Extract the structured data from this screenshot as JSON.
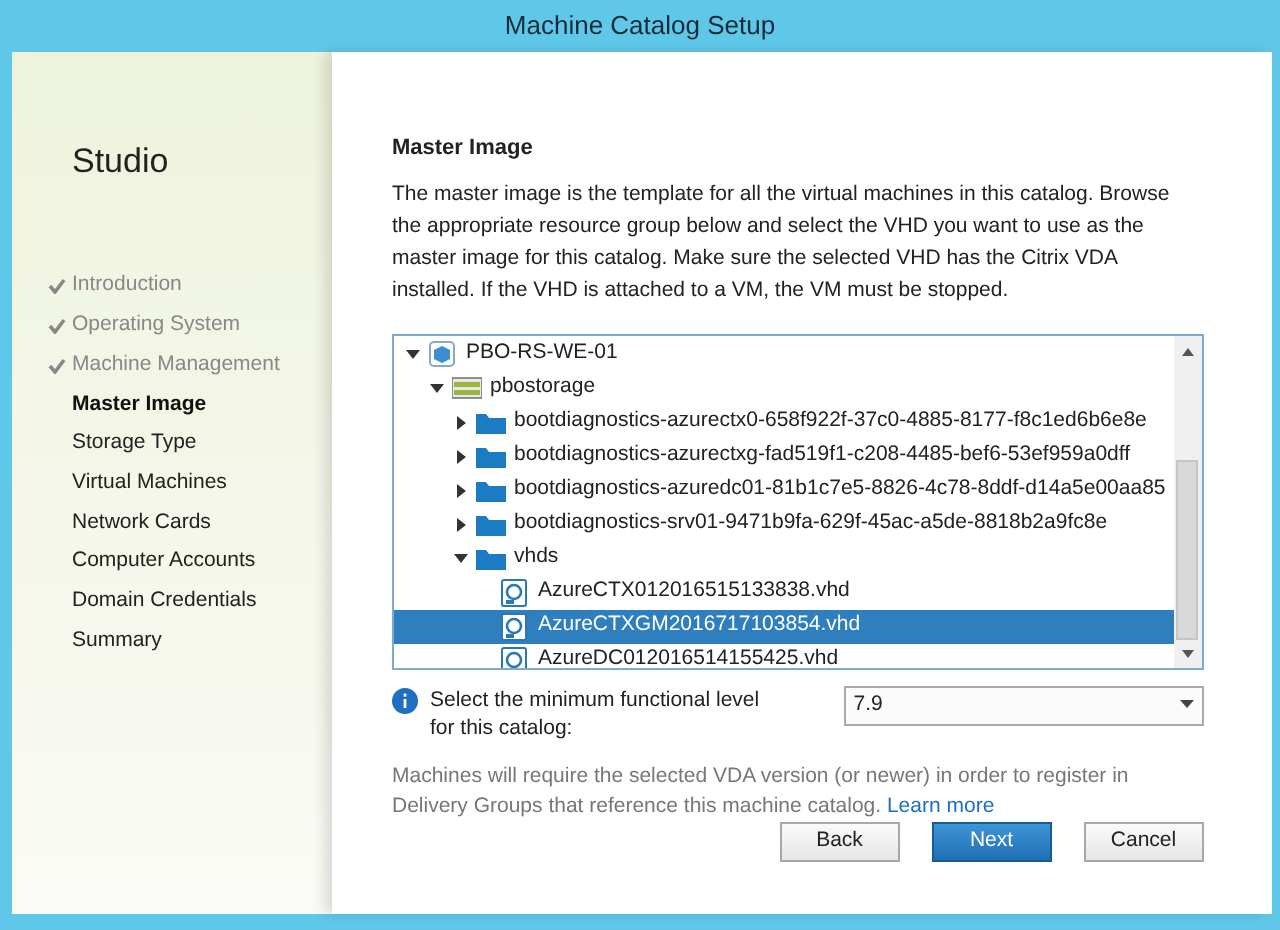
{
  "window": {
    "title": "Machine Catalog Setup"
  },
  "sidebar": {
    "title": "Studio",
    "items": [
      {
        "label": "Introduction",
        "done": true,
        "selected": false
      },
      {
        "label": "Operating System",
        "done": true,
        "selected": false
      },
      {
        "label": "Machine Management",
        "done": true,
        "selected": false
      },
      {
        "label": "Master Image",
        "done": false,
        "selected": true
      },
      {
        "label": "Storage Type",
        "done": false,
        "selected": false
      },
      {
        "label": "Virtual Machines",
        "done": false,
        "selected": false
      },
      {
        "label": "Network Cards",
        "done": false,
        "selected": false
      },
      {
        "label": "Computer Accounts",
        "done": false,
        "selected": false
      },
      {
        "label": "Domain Credentials",
        "done": false,
        "selected": false
      },
      {
        "label": "Summary",
        "done": false,
        "selected": false
      }
    ]
  },
  "page": {
    "heading": "Master Image",
    "description": "The master image is the template for all the virtual machines in this catalog. Browse the appropriate resource group below and select the VHD you want to use as the master image for this catalog. Make sure the selected VHD has the Citrix VDA installed. If the VHD is attached to a VM, the VM must be stopped.",
    "tree": [
      {
        "label": "PBO-RS-WE-01",
        "kind": "group",
        "expanded": true,
        "selected": false,
        "children": [
          {
            "label": "pbostorage",
            "kind": "storage",
            "expanded": true,
            "selected": false,
            "children": [
              {
                "label": "bootdiagnostics-azurectx0-658f922f-37c0-4885-8177-f8c1ed6b6e8e",
                "kind": "folder",
                "expanded": false,
                "selected": false
              },
              {
                "label": "bootdiagnostics-azurectxg-fad519f1-c208-4485-bef6-53ef959a0dff",
                "kind": "folder",
                "expanded": false,
                "selected": false
              },
              {
                "label": "bootdiagnostics-azuredc01-81b1c7e5-8826-4c78-8ddf-d14a5e00aa85",
                "kind": "folder",
                "expanded": false,
                "selected": false
              },
              {
                "label": "bootdiagnostics-srv01-9471b9fa-629f-45ac-a5de-8818b2a9fc8e",
                "kind": "folder",
                "expanded": false,
                "selected": false
              },
              {
                "label": "vhds",
                "kind": "folder",
                "expanded": true,
                "selected": false,
                "children": [
                  {
                    "label": "AzureCTX012016515133838.vhd",
                    "kind": "disk",
                    "selected": false
                  },
                  {
                    "label": "AzureCTXGM2016717103854.vhd",
                    "kind": "disk",
                    "selected": true
                  },
                  {
                    "label": "AzureDC012016514155425.vhd",
                    "kind": "disk",
                    "selected": false
                  }
                ]
              }
            ]
          }
        ]
      }
    ],
    "level_label": "Select the minimum functional level for this catalog:",
    "level_value": "7.9",
    "note": "Machines will require the selected VDA version (or newer) in order to register in Delivery Groups that reference this machine catalog.",
    "note_link": "Learn more",
    "buttons": [
      {
        "label": "Back",
        "kind": "normal"
      },
      {
        "label": "Next",
        "kind": "primary"
      },
      {
        "label": "Cancel",
        "kind": "normal"
      }
    ]
  }
}
